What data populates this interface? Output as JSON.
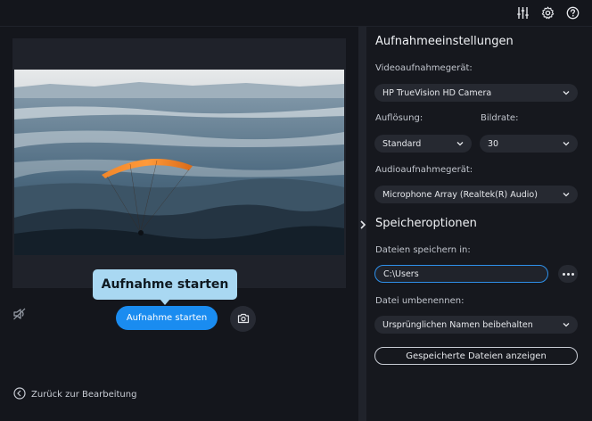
{
  "tooltip": {
    "text": "Aufnahme starten"
  },
  "controls": {
    "start_label": "Aufnahme starten"
  },
  "footer": {
    "back_label": "Zurück zur Bearbeitung"
  },
  "settings": {
    "recording_title": "Aufnahmeeinstellungen",
    "video_device_label": "Videoaufnahmegerät:",
    "video_device_value": "HP TrueVision HD Camera",
    "resolution_label": "Auflösung:",
    "resolution_value": "Standard",
    "framerate_label": "Bildrate:",
    "framerate_value": "30",
    "audio_device_label": "Audioaufnahmegerät:",
    "audio_device_value": "Microphone Array (Realtek(R) Audio)",
    "storage_title": "Speicheroptionen",
    "save_in_label": "Dateien speichern in:",
    "save_in_value": "C:\\Users",
    "rename_label": "Datei umbenennen:",
    "rename_value": "Ursprünglichen Namen beibehalten",
    "show_files_label": "Gespeicherte Dateien anzeigen"
  },
  "colors": {
    "accent": "#1a8cf0",
    "tooltip_bg": "#a9d8f2",
    "panel_bg": "#16181e",
    "app_bg": "#14161c"
  }
}
